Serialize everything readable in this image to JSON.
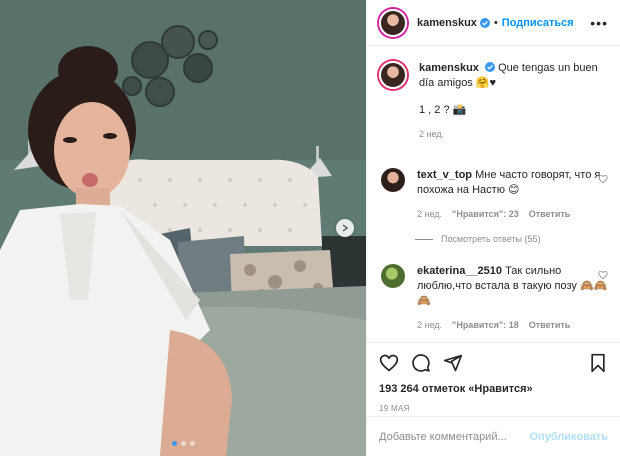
{
  "header": {
    "username": "kamenskux",
    "separator": "•",
    "follow_label": "Подписаться",
    "more_label": "•••"
  },
  "caption": {
    "username": "kamenskux",
    "text": "Que tengas un buen día amigos 🤗♥",
    "extra": "1 , 2 ? 📸",
    "time": "2 нед."
  },
  "comments": [
    {
      "username": "text_v_top",
      "text": "Мне часто говорят, что я похожа на Настю 😊",
      "time": "2 нед.",
      "likes": "\"Нравится\": 23",
      "reply_label": "Ответить",
      "view_replies": "Посмотреть ответы (55)"
    },
    {
      "username": "ekaterina__2510",
      "text": "Так сильно люблю,что встала в такую позу 🙈🙈🙈",
      "time": "2 нед.",
      "likes": "\"Нравится\": 18",
      "reply_label": "Ответить"
    }
  ],
  "actions": {
    "icons": [
      "heart-icon",
      "comment-icon",
      "share-icon",
      "bookmark-icon"
    ],
    "likes_text": "193 264 отметок «Нравится»",
    "date": "19 МАЯ"
  },
  "add_comment": {
    "placeholder": "Добавьте комментарий...",
    "publish_label": "Опубликовать"
  },
  "carousel": {
    "slide_count": 3,
    "active_index": 0
  },
  "colors": {
    "accent": "#0095f6",
    "verified": "#3897f0",
    "muted": "#8e8e8e",
    "wall": "#5d7a73"
  }
}
